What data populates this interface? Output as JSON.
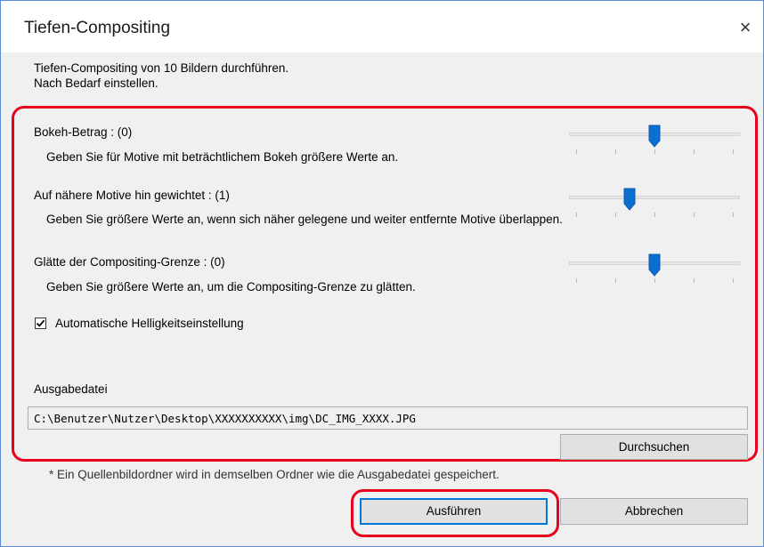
{
  "window": {
    "title": "Tiefen-Compositing",
    "close_symbol": "×"
  },
  "intro": {
    "line1": "Tiefen-Compositing von 10 Bildern durchführen.",
    "line2": "Nach Bedarf einstellen."
  },
  "settings": [
    {
      "label": "Bokeh-Betrag : (0)",
      "description": "Geben Sie für Motive mit beträchtlichem Bokeh größere Werte an.",
      "slider_level": 0.5
    },
    {
      "label": "Auf nähere Motive hin gewichtet : (1)",
      "description": "Geben Sie größere Werte an, wenn sich näher gelegene und weiter entfernte Motive überlappen.",
      "slider_level": 0.34
    },
    {
      "label": "Glätte der Compositing-Grenze : (0)",
      "description": "Geben Sie größere Werte an, um die Compositing-Grenze zu glätten.",
      "slider_level": 0.5
    }
  ],
  "auto_brightness": {
    "label": "Automatische Helligkeitseinstellung",
    "checked": true
  },
  "output": {
    "label": "Ausgabedatei",
    "path": "C:\\Benutzer\\Nutzer\\Desktop\\XXXXXXXXXX\\img\\DC_IMG_XXXX.JPG",
    "browse_label": "Durchsuchen"
  },
  "note": "* Ein Quellenbildordner wird in demselben Ordner wie die Ausgabedatei gespeichert.",
  "buttons": {
    "run": "Ausführen",
    "cancel": "Abbrechen"
  },
  "colors": {
    "highlight": "#e8001c",
    "slider_thumb": "#0a6fd0",
    "default_button_border": "#0078d7"
  }
}
